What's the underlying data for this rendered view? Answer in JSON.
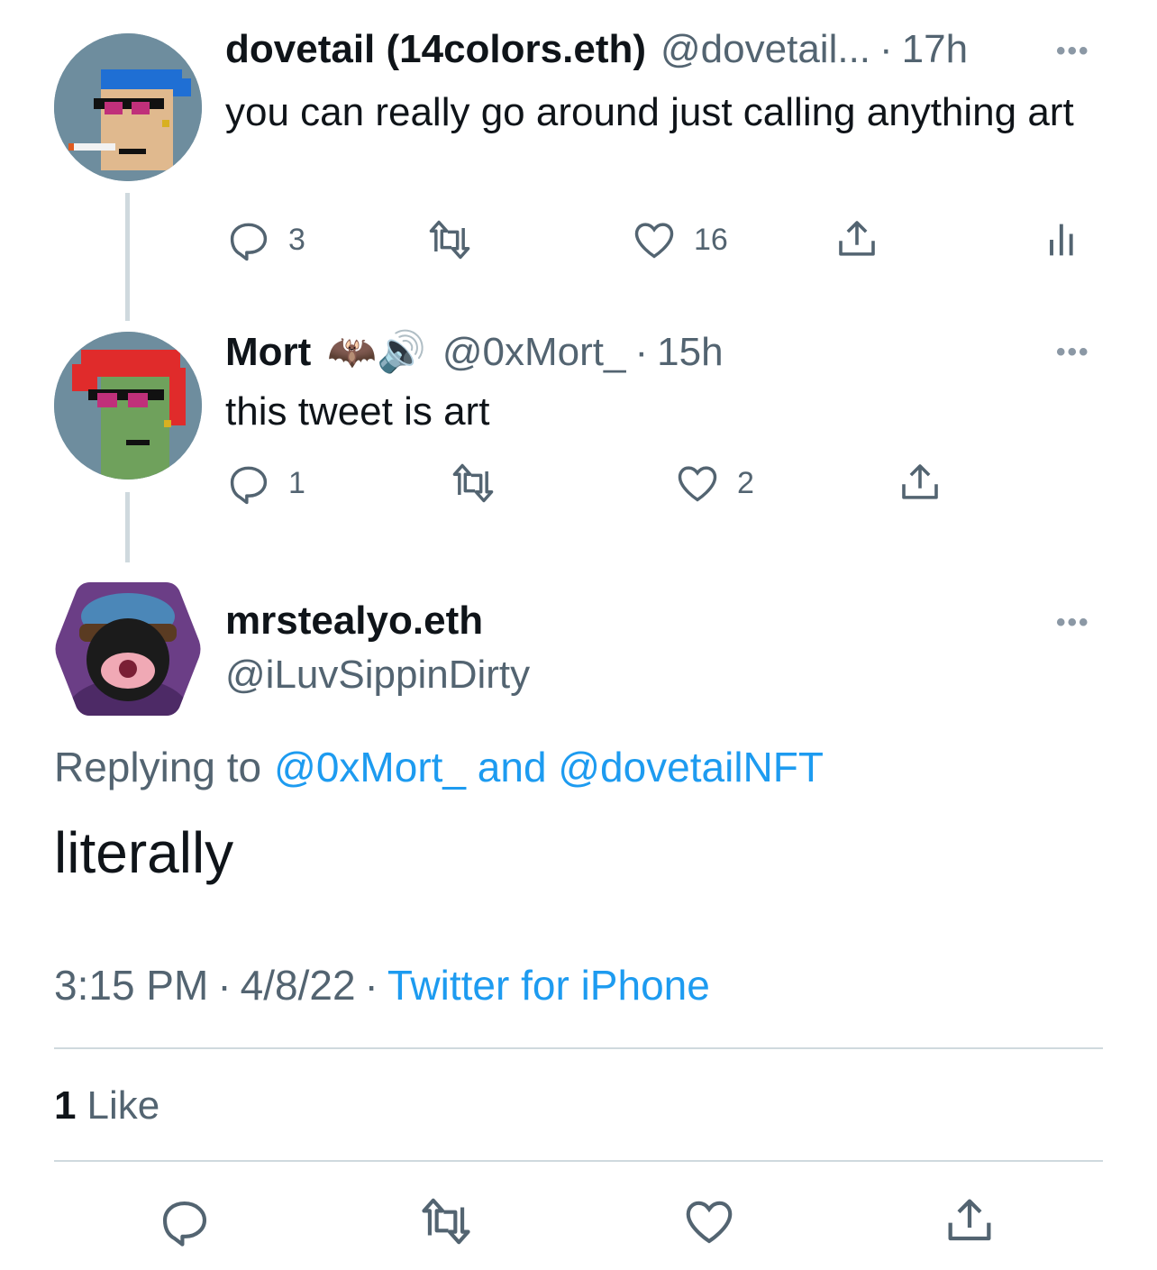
{
  "thread": [
    {
      "name": "dovetail (14colors.eth)",
      "handle": "@dovetail...",
      "time": "17h",
      "text": "you can really go around just calling anything art",
      "replies": "3",
      "retweets": "",
      "likes": "16",
      "colors": {
        "avatar_bg": "#6e8d9e",
        "hair": "#1f6fd4"
      }
    },
    {
      "name": "Mort",
      "emojis": "🦇🔊",
      "handle": "@0xMort_",
      "time": "15h",
      "text": "this tweet is art",
      "replies": "1",
      "retweets": "",
      "likes": "2",
      "colors": {
        "avatar_bg": "#6e8d9e",
        "hair": "#e02b2b",
        "skin": "#6fa15c"
      }
    }
  ],
  "main_tweet": {
    "name": "mrstealyo.eth",
    "handle": "@iLuvSippinDirty",
    "replying_prefix": "Replying to",
    "replying_to": "@0xMort_ and @dovetailNFT",
    "text": "literally",
    "time": "3:15 PM",
    "date": "4/8/22",
    "source": "Twitter for iPhone",
    "likes_count": "1",
    "likes_label": "Like"
  },
  "icons": [
    "reply-icon",
    "retweet-icon",
    "like-icon",
    "share-icon",
    "analytics-icon",
    "more-icon"
  ],
  "colors": {
    "text": "#0f1419",
    "secondary": "#536471",
    "link": "#1d9bf0",
    "divider": "#cfd9de"
  }
}
